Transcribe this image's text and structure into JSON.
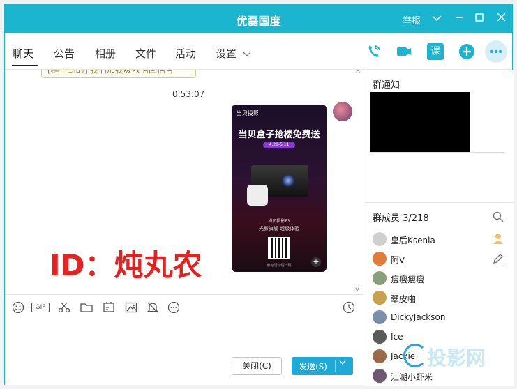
{
  "window": {
    "title": "优磊国度",
    "report": "举报"
  },
  "tabs": [
    {
      "label": "聊天"
    },
    {
      "label": "公告"
    },
    {
      "label": "相册"
    },
    {
      "label": "文件"
    },
    {
      "label": "活动"
    },
    {
      "label": "设置"
    }
  ],
  "tab_icons": [
    "phone-icon",
    "video-icon",
    "class-icon",
    "add-icon",
    "more-icon"
  ],
  "class_icon_text": "课",
  "chat": {
    "top_bubble_text": "[群主到的] 我们加我吸收信回信号",
    "timestamp": "0:53:07",
    "poster": {
      "brand": "当贝投影",
      "headline": "当贝盒子抢楼免费送",
      "date": "4.28-5.11",
      "model": "当贝投影F3",
      "slogan": "光影旗舰  超级体验",
      "qr_note": "参与活动请扫码"
    },
    "overlay_id": "ID：炖丸农"
  },
  "toolbar_icons": [
    "emoji-icon",
    "gif-icon",
    "scissors-icon",
    "folder-icon",
    "sticker-icon",
    "image-icon",
    "bell-off-icon",
    "more-circle-icon",
    "history-icon"
  ],
  "gif_label": "GIF",
  "buttons": {
    "close": "关闭(C)",
    "send": "发送(S)"
  },
  "right": {
    "notice_title": "群通知",
    "members_title": "群成员 3/218",
    "members": [
      {
        "name": "皇后Ksenia",
        "color": "#c9c9c9"
      },
      {
        "name": "阿V",
        "color": "#e07b39"
      },
      {
        "name": "瘦瘦瘦瘦",
        "color": "#8aa07a"
      },
      {
        "name": "翠皮啪",
        "color": "#c7a14d"
      },
      {
        "name": "DickyJackson",
        "color": "#7b8fa8"
      },
      {
        "name": "Ice",
        "color": "#5a5a5a"
      },
      {
        "name": "Jackie",
        "color": "#9a6a4a"
      },
      {
        "name": "江湖小虾米",
        "color": "#6d5a6e"
      }
    ]
  },
  "watermark": {
    "text": "投影网"
  },
  "colors": {
    "accent": "#1bb5cf",
    "send": "#1fa9d6",
    "red": "#e8201e"
  }
}
